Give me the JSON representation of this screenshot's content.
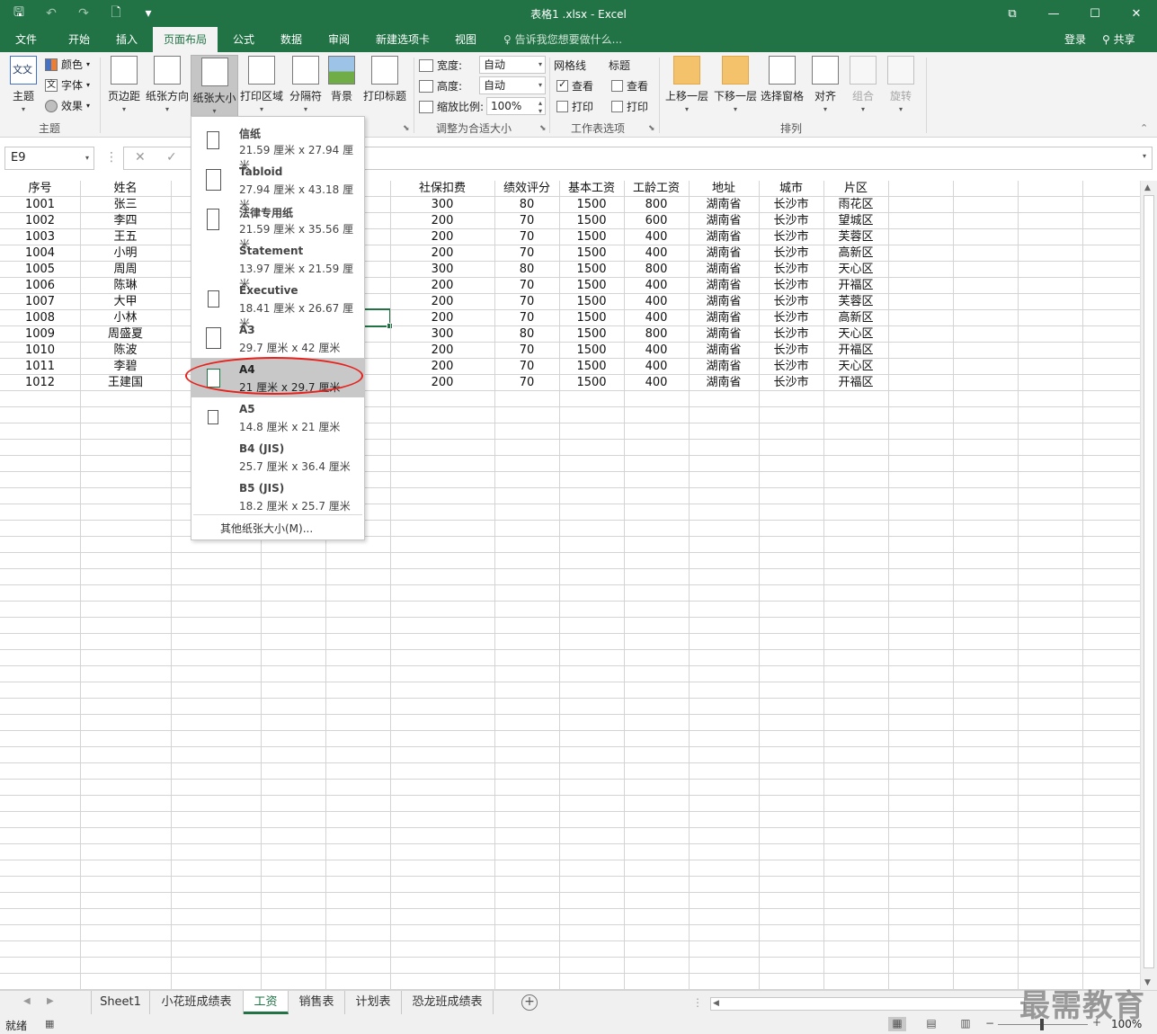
{
  "window": {
    "title": "表格1 .xlsx - Excel"
  },
  "tabs": {
    "items": [
      "文件",
      "开始",
      "插入",
      "页面布局",
      "公式",
      "数据",
      "审阅",
      "新建选项卡",
      "视图"
    ],
    "active": "页面布局",
    "tell_me": "告诉我您想要做什么...",
    "login": "登录",
    "share": "共享"
  },
  "ribbon": {
    "themes": {
      "theme": "主题",
      "colors": "颜色",
      "fonts": "字体",
      "effects": "效果",
      "group": "主题"
    },
    "page_setup": {
      "margins": "页边距",
      "orientation": "纸张方向",
      "size": "纸张大小",
      "print_area": "打印区域",
      "breaks": "分隔符",
      "background": "背景",
      "print_titles": "打印标题"
    },
    "scale": {
      "width_label": "宽度:",
      "width_value": "自动",
      "height_label": "高度:",
      "height_value": "自动",
      "scale_label": "缩放比例:",
      "scale_value": "100%",
      "group": "调整为合适大小"
    },
    "sheet_options": {
      "gridlines": "网格线",
      "headings": "标题",
      "view": "查看",
      "print": "打印",
      "group": "工作表选项"
    },
    "arrange": {
      "bring_forward": "上移一层",
      "send_backward": "下移一层",
      "selection_pane": "选择窗格",
      "align": "对齐",
      "group_btn": "组合",
      "rotate": "旋转",
      "group": "排列"
    }
  },
  "formula_bar": {
    "name_box": "E9"
  },
  "sheet": {
    "headers": [
      "序号",
      "姓名",
      "",
      "",
      "龄",
      "社保扣费",
      "绩效评分",
      "基本工资",
      "工龄工资",
      "地址",
      "城市",
      "片区"
    ],
    "rows": [
      [
        "1001",
        "张三",
        "",
        "",
        "",
        "300",
        "80",
        "1500",
        "800",
        "湖南省",
        "长沙市",
        "雨花区"
      ],
      [
        "1002",
        "李四",
        "",
        "",
        "",
        "200",
        "70",
        "1500",
        "600",
        "湖南省",
        "长沙市",
        "望城区"
      ],
      [
        "1003",
        "王五",
        "",
        "",
        "",
        "200",
        "70",
        "1500",
        "400",
        "湖南省",
        "长沙市",
        "芙蓉区"
      ],
      [
        "1004",
        "小明",
        "",
        "",
        "",
        "200",
        "70",
        "1500",
        "400",
        "湖南省",
        "长沙市",
        "高新区"
      ],
      [
        "1005",
        "周周",
        "",
        "",
        "",
        "300",
        "80",
        "1500",
        "800",
        "湖南省",
        "长沙市",
        "天心区"
      ],
      [
        "1006",
        "陈琳",
        "",
        "",
        "",
        "200",
        "70",
        "1500",
        "400",
        "湖南省",
        "长沙市",
        "开福区"
      ],
      [
        "1007",
        "大甲",
        "",
        "",
        "",
        "200",
        "70",
        "1500",
        "400",
        "湖南省",
        "长沙市",
        "芙蓉区"
      ],
      [
        "1008",
        "小林",
        "",
        "",
        "",
        "200",
        "70",
        "1500",
        "400",
        "湖南省",
        "长沙市",
        "高新区"
      ],
      [
        "1009",
        "周盛夏",
        "",
        "",
        "",
        "300",
        "80",
        "1500",
        "800",
        "湖南省",
        "长沙市",
        "天心区"
      ],
      [
        "1010",
        "陈波",
        "",
        "",
        "",
        "200",
        "70",
        "1500",
        "400",
        "湖南省",
        "长沙市",
        "开福区"
      ],
      [
        "1011",
        "李碧",
        "",
        "",
        "",
        "200",
        "70",
        "1500",
        "400",
        "湖南省",
        "长沙市",
        "天心区"
      ],
      [
        "1012",
        "王建国",
        "",
        "",
        "",
        "200",
        "70",
        "1500",
        "400",
        "湖南省",
        "长沙市",
        "开福区"
      ]
    ]
  },
  "paper_menu": {
    "items": [
      {
        "name": "信纸",
        "dims": "21.59 厘米 x 27.94 厘米"
      },
      {
        "name": "Tabloid",
        "dims": "27.94 厘米 x 43.18 厘米"
      },
      {
        "name": "法律专用纸",
        "dims": "21.59 厘米 x 35.56 厘米"
      },
      {
        "name": "Statement",
        "dims": "13.97 厘米 x 21.59 厘米"
      },
      {
        "name": "Executive",
        "dims": "18.41 厘米 x 26.67 厘米"
      },
      {
        "name": "A3",
        "dims": "29.7 厘米 x 42 厘米"
      },
      {
        "name": "A4",
        "dims": "21 厘米 x 29.7 厘米"
      },
      {
        "name": "A5",
        "dims": "14.8 厘米 x 21 厘米"
      },
      {
        "name": "B4 (JIS)",
        "dims": "25.7 厘米 x 36.4 厘米"
      },
      {
        "name": "B5 (JIS)",
        "dims": "18.2 厘米 x 25.7 厘米"
      }
    ],
    "selected": "A4",
    "more": "其他纸张大小(M)..."
  },
  "sheet_tabs": {
    "items": [
      "Sheet1",
      "小花班成绩表",
      "工资",
      "销售表",
      "计划表",
      "恐龙班成绩表"
    ],
    "active": "工资"
  },
  "status": {
    "ready": "就绪",
    "zoom": "100%"
  },
  "watermark": "最需教育",
  "colors": {
    "accent": "#217346",
    "highlight_ring": "#e8211c"
  }
}
